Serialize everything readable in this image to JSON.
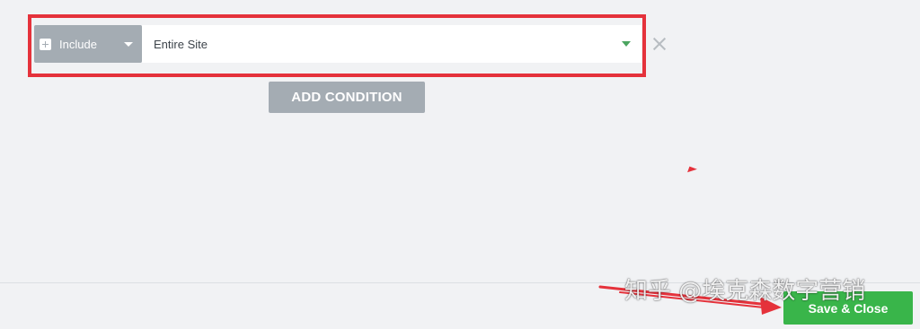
{
  "condition": {
    "type_label": "Include",
    "scope_value": "Entire Site"
  },
  "actions": {
    "add_condition_label": "ADD CONDITION",
    "save_close_label": "Save & Close"
  },
  "watermark": {
    "text": "知乎 @埃克森数字营销"
  },
  "icons": {
    "plus": "plus-icon",
    "remove": "close-icon",
    "type_caret": "chevron-down-icon",
    "scope_caret": "chevron-down-icon"
  },
  "colors": {
    "background": "#f1f2f4",
    "select_grey": "#a4acb3",
    "highlight_red": "#e5323b",
    "save_green": "#39b54a",
    "scope_caret_green": "#4ba560"
  }
}
